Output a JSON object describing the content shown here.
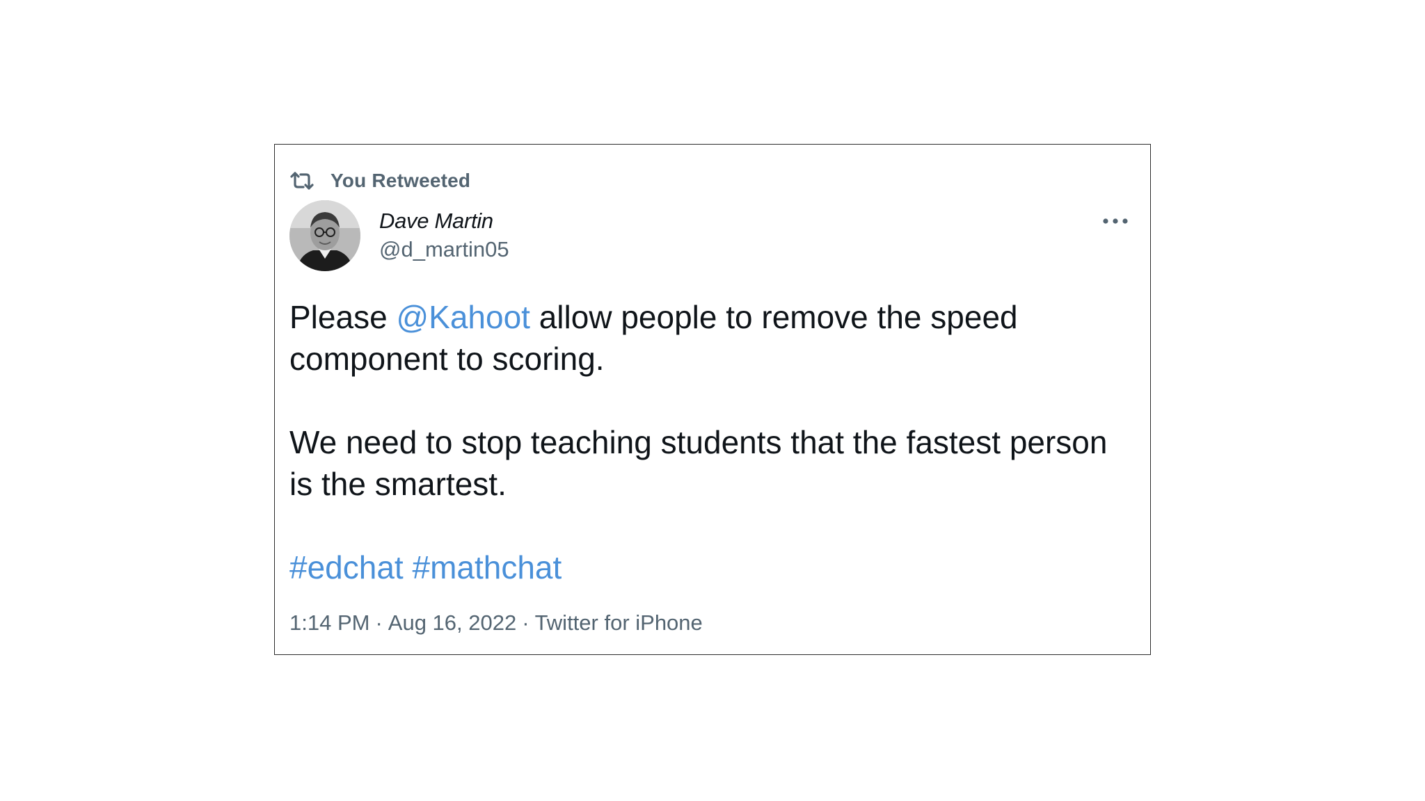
{
  "retweet": {
    "label": "You Retweeted",
    "icon": "retweet-icon"
  },
  "author": {
    "name": "Dave Martin",
    "handle": "@d_martin05",
    "avatar": "avatar-photo"
  },
  "tweet": {
    "line1_before": "Please ",
    "mention": "@Kahoot",
    "line1_after": " allow people to remove the speed component to scoring.",
    "paragraph2": "We need to stop teaching students that the fastest person is the smartest.",
    "hashtag1": "#edchat",
    "hashtag2": "#mathchat"
  },
  "meta": {
    "time": "1:14 PM",
    "separator": "·",
    "date": "Aug 16, 2022",
    "source": "Twitter for iPhone"
  },
  "colors": {
    "link": "#4a90d9",
    "secondary_text": "#536471",
    "primary_text": "#0f1419",
    "border": "#2a2a2a"
  },
  "more_icon": "more-dots-icon"
}
